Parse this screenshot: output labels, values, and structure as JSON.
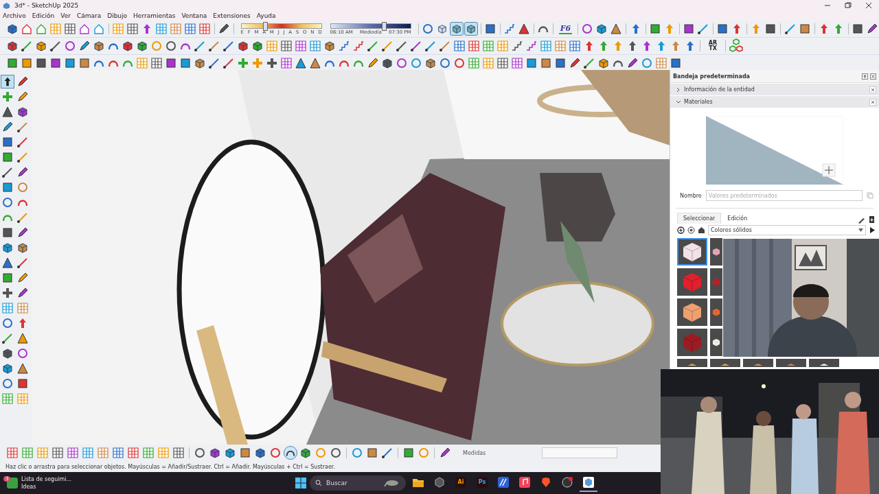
{
  "window": {
    "title": "3d* - SketchUp 2025"
  },
  "menu": [
    "Archivo",
    "Edición",
    "Ver",
    "Cámara",
    "Dibujo",
    "Herramientas",
    "Ventana",
    "Extensiones",
    "Ayuda"
  ],
  "shadows": {
    "months": [
      "E",
      "F",
      "M",
      "A",
      "M",
      "J",
      "J",
      "A",
      "S",
      "O",
      "N",
      "D"
    ],
    "date_slider": {
      "level": 0.3
    },
    "time_slider": {
      "level": 0.67
    },
    "times": [
      "06:10 AM",
      "Mediodía",
      "07:30 PM"
    ]
  },
  "view_buttons": [
    {
      "selected": false
    },
    {
      "selected": true
    },
    {
      "selected": true
    }
  ],
  "f6_label": "F6",
  "artx_label": "AR TX",
  "tool_palette": {
    "select_tool": {
      "selected": true
    }
  },
  "tray": {
    "title": "Bandeja predeterminada",
    "sections": [
      {
        "label": "Información de la entidad",
        "expanded": false
      },
      {
        "label": "Materiales",
        "expanded": true
      }
    ],
    "name_label": "Nombre",
    "name_placeholder": "Valores predeterminados",
    "tabs": [
      {
        "label": "Seleccionar",
        "selected": true
      },
      {
        "label": "Edición",
        "selected": false
      }
    ],
    "library": "Colores sólidos",
    "swatch_rows": [
      [
        {
          "color": "#f2e1e6",
          "selected": true
        },
        {
          "color": "#e8a8b8",
          "selected": false
        }
      ],
      [
        {
          "color": "#e0202c",
          "selected": false
        },
        {
          "color": "#c41c2a",
          "selected": false
        }
      ],
      [
        {
          "color": "#f0a070",
          "selected": false
        },
        {
          "color": "#e86a30",
          "selected": false
        }
      ],
      [
        {
          "color": "#9c1c24",
          "selected": false
        },
        {
          "color": "#f5f0ea",
          "selected": false
        }
      ],
      [
        {
          "color": "#e8a040",
          "selected": false
        },
        {
          "color": "#e8a040",
          "selected": false
        },
        {
          "color": "#d89040",
          "selected": false
        },
        {
          "color": "#d08048",
          "selected": false
        },
        {
          "color": "#f0f0f0",
          "selected": false
        }
      ]
    ]
  },
  "bottom_bar": {
    "orbit_tool": {
      "selected": true
    },
    "measure_label": "Medidas"
  },
  "status_bar": "Haz clic o arrastra para seleccionar objetos. Mayúsculas = Añadir/Sustraer. Ctrl = Añadir. Mayúsculas + Ctrl = Sustraer.",
  "taskbar": {
    "widget_badge": "3",
    "widget_title": "Lista de seguimi...",
    "widget_subtitle": "Ideas",
    "search_placeholder": "Buscar",
    "apps": [
      {
        "kind": "folder",
        "selected": false
      },
      {
        "kind": "hexagon",
        "selected": false
      },
      {
        "kind": "tile",
        "label": "Ai",
        "selected": false
      },
      {
        "kind": "tile",
        "label": "Ps",
        "selected": false
      },
      {
        "kind": "blue",
        "selected": false
      },
      {
        "kind": "music",
        "selected": false
      },
      {
        "kind": "shield",
        "selected": false
      },
      {
        "kind": "record",
        "selected": false
      },
      {
        "kind": "cube",
        "selected": true
      }
    ]
  }
}
